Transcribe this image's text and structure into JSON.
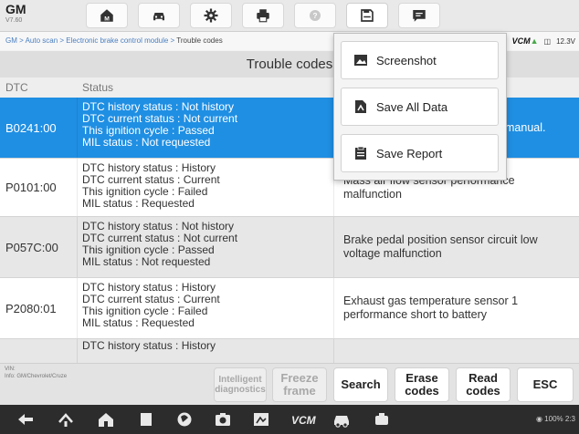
{
  "app": {
    "title": "GM",
    "version": "V7.60"
  },
  "toolbar": {
    "icons": [
      "home-icon",
      "vehicle-icon",
      "settings-icon",
      "print-icon",
      "help-icon",
      "save-icon",
      "message-icon"
    ]
  },
  "breadcrumb": {
    "items": [
      "GM",
      "Auto scan",
      "Electronic brake control module",
      "Trouble codes"
    ],
    "sep": " > ",
    "text_1": "GM > Auto scan > Electronic brake control module > ",
    "current": "Trouble codes"
  },
  "status": {
    "vcm_label": "VCM",
    "voltage": "12.3V"
  },
  "page_title": "Trouble codes",
  "table": {
    "headers": {
      "dtc": "DTC",
      "status": "Status"
    },
    "rows": [
      {
        "code": "B0241:00",
        "status": [
          "DTC history status : Not history",
          "DTC current status : Not current",
          "This ignition cycle : Passed",
          "MIL status : Not requested"
        ],
        "description": "manual."
      },
      {
        "code": "P0101:00",
        "status": [
          "DTC history status : History",
          "DTC current status : Current",
          "This ignition cycle : Failed",
          "MIL status : Requested"
        ],
        "description": "Mass air flow sensor performance malfunction"
      },
      {
        "code": "P057C:00",
        "status": [
          "DTC history status : Not history",
          "DTC current status : Not current",
          "This ignition cycle : Passed",
          "MIL status : Not requested"
        ],
        "description": "Brake pedal position sensor circuit low voltage malfunction"
      },
      {
        "code": "P2080:01",
        "status": [
          "DTC history status : History",
          "DTC current status : Current",
          "This ignition cycle : Failed",
          "MIL status : Requested"
        ],
        "description": "Exhaust gas temperature sensor 1 performance short to battery"
      },
      {
        "code": "",
        "status": [
          "DTC history status : History"
        ],
        "description": ""
      }
    ]
  },
  "save_menu": {
    "screenshot": "Screenshot",
    "save_all_data": "Save All Data",
    "save_report": "Save Report"
  },
  "footer": {
    "vin_label": "VIN:",
    "info": "Info: GM/Chevrolet/Cruze",
    "buttons": {
      "intelligent_diagnostics_1": "Intelligent",
      "intelligent_diagnostics_2": "diagnostics",
      "freeze_frame_1": "Freeze",
      "freeze_frame_2": "frame",
      "search": "Search",
      "erase_codes_1": "Erase",
      "erase_codes_2": "codes",
      "read_codes_1": "Read",
      "read_codes_2": "codes",
      "esc": "ESC"
    }
  },
  "system_bar": {
    "battery": "100%",
    "time": "2:3"
  },
  "colors": {
    "selected_row": "#1f8fe3",
    "vcm_accent": "#48a84a",
    "nav_bg": "#2c2c2c"
  }
}
